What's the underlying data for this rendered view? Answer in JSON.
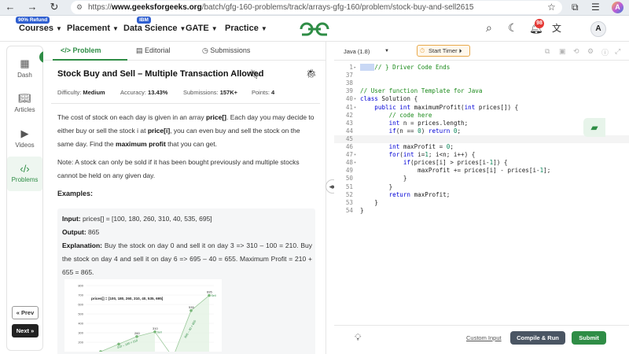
{
  "browser": {
    "url_prefix": "https://",
    "url_domain": "www.geeksforgeeks.org",
    "url_path": "/batch/gfg-160-problems/track/arrays-gfg-160/problem/stock-buy-and-sell2615",
    "profile_letter": "A"
  },
  "header": {
    "nav": [
      {
        "label": "Courses",
        "badge": "90% Refund"
      },
      {
        "label": "Placement",
        "badge": ""
      },
      {
        "label": "Data Science",
        "badge": "IBM"
      },
      {
        "label": "GATE",
        "badge": ""
      },
      {
        "label": "Practice",
        "badge": ""
      }
    ],
    "logo_text": "GG",
    "notification_count": "98",
    "avatar_letter": "A"
  },
  "sidebar": {
    "items": [
      {
        "label": "Dash",
        "icon": "grid-icon"
      },
      {
        "label": "Articles",
        "icon": "book-icon"
      },
      {
        "label": "Videos",
        "icon": "play-icon"
      },
      {
        "label": "Problems",
        "icon": "code-icon"
      }
    ],
    "prev_label": "« Prev",
    "next_label": "Next »"
  },
  "problem": {
    "tabs": [
      {
        "label": "</> Problem"
      },
      {
        "label": "Editorial"
      },
      {
        "label": "Submissions"
      }
    ],
    "title": "Stock Buy and Sell – Multiple Transaction Allowed",
    "difficulty_label": "Difficulty:",
    "difficulty": "Medium",
    "accuracy_label": "Accuracy:",
    "accuracy": "13.43%",
    "submissions_label": "Submissions:",
    "submissions": "157K+",
    "points_label": "Points:",
    "points": "4",
    "desc_1a": "The cost of stock on each day is given in an array ",
    "desc_1b": "price[]",
    "desc_1c": ". Each day you may decide to either buy or sell the stock i at ",
    "desc_1d": "price[i]",
    "desc_1e": ", you can even buy and sell the stock on the same day. Find the ",
    "desc_1f": "maximum profit",
    "desc_1g": " that you can get.",
    "note": "Note: A stock can only be sold if it has been bought previously and multiple stocks cannot be held on any given day.",
    "examples_heading": "Examples:",
    "ex_input_label": "Input:",
    "ex_input": " prices[] = [100, 180, 260, 310, 40, 535, 695]",
    "ex_output_label": "Output:",
    "ex_output": " 865",
    "ex_expl_label": "Explanation:",
    "ex_expl": " Buy the stock on day 0 and sell it on day 3 => 310 – 100 = 210. Buy the stock on day 4 and sell it on day 6 => 695 – 40 = 655. Maximum Profit = 210 + 655 = 865."
  },
  "chart_data": {
    "type": "line",
    "title": "prices[] = [100, 180, 260, 310, 40, 535, 695]",
    "x": [
      0,
      1,
      2,
      3,
      4,
      5,
      6
    ],
    "values": [
      100,
      180,
      260,
      310,
      40,
      535,
      695
    ],
    "point_labels": [
      "",
      "",
      "260",
      "310",
      "",
      "535",
      "695"
    ],
    "annotations": [
      {
        "text": "310 – 100 = 210",
        "from": 0,
        "to": 3
      },
      {
        "text": "695 – 40 = 655",
        "from": 4,
        "to": 6
      }
    ],
    "sell_label": "Sell",
    "yticks": [
      200,
      300,
      400,
      500,
      600,
      700,
      800
    ],
    "ylim": [
      100,
      800
    ],
    "colors": {
      "buy": "#7ab87a",
      "sell": "#2f8d46",
      "line": "#9cc99c"
    }
  },
  "editor": {
    "language": "Java (1.8)",
    "timer_label": "Start Timer",
    "lines": [
      {
        "n": "1",
        "fold": "▸",
        "html": "<span class='cm'>// } Driver Code Ends</span>"
      },
      {
        "n": "37",
        "fold": "",
        "html": ""
      },
      {
        "n": "38",
        "fold": "",
        "html": ""
      },
      {
        "n": "39",
        "fold": "",
        "html": "<span class='cm'>// User function Template for Java</span>"
      },
      {
        "n": "40",
        "fold": "▾",
        "html": "<span class='kw'>class</span> Solution {"
      },
      {
        "n": "41",
        "fold": "▾",
        "html": "    <span class='kw'>public int</span> maximumProfit(<span class='kw'>int</span> prices[]) {"
      },
      {
        "n": "42",
        "fold": "",
        "html": "        <span class='cm'>// code here</span>"
      },
      {
        "n": "43",
        "fold": "",
        "html": "        <span class='kw'>int</span> n = prices.length;"
      },
      {
        "n": "44",
        "fold": "",
        "html": "        <span class='kw'>if</span>(n == <span class='num'>0</span>) <span class='kw'>return</span> <span class='num'>0</span>;"
      },
      {
        "n": "45",
        "fold": "",
        "html": "        "
      },
      {
        "n": "46",
        "fold": "",
        "html": "        <span class='kw'>int</span> maxProfit = <span class='num'>0</span>;"
      },
      {
        "n": "47",
        "fold": "▾",
        "html": "        <span class='kw'>for</span>(<span class='kw'>int</span> i=<span class='num'>1</span>; i&lt;n; i++) {"
      },
      {
        "n": "48",
        "fold": "▾",
        "html": "            <span class='kw'>if</span>(prices[i] &gt; prices[i-<span class='num'>1</span>]) {"
      },
      {
        "n": "49",
        "fold": "",
        "html": "                maxProfit += prices[i] - prices[i-<span class='num'>1</span>];"
      },
      {
        "n": "50",
        "fold": "",
        "html": "            }"
      },
      {
        "n": "51",
        "fold": "",
        "html": "        }"
      },
      {
        "n": "52",
        "fold": "",
        "html": "        <span class='kw'>return</span> maxProfit;"
      },
      {
        "n": "53",
        "fold": "",
        "html": "    }"
      },
      {
        "n": "54",
        "fold": "",
        "html": "}"
      }
    ],
    "custom_input_label": "Custom Input",
    "compile_label": "Compile & Run",
    "submit_label": "Submit"
  }
}
